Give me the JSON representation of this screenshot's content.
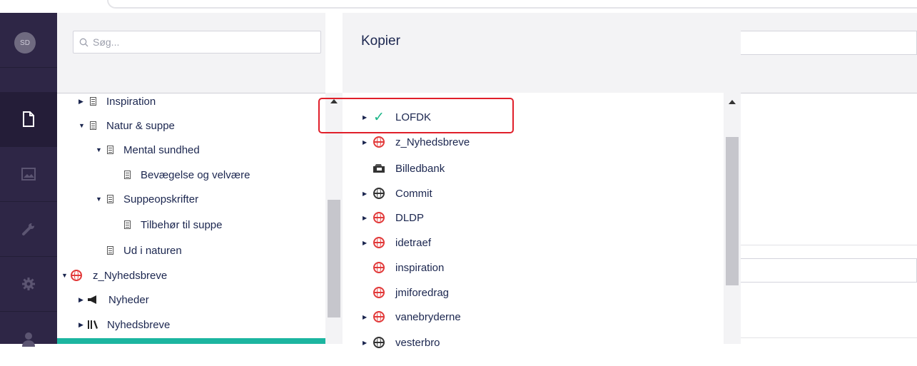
{
  "user": {
    "initials": "SD"
  },
  "search": {
    "placeholder": "Søg..."
  },
  "dialog": {
    "title": "Kopier"
  },
  "tree": [
    {
      "label": "Inspiration"
    },
    {
      "label": "Natur & suppe"
    },
    {
      "label": "Mental sundhed"
    },
    {
      "label": "Bevægelse og velvære"
    },
    {
      "label": "Suppeopskrifter"
    },
    {
      "label": "Tilbehør til suppe"
    },
    {
      "label": "Ud i naturen"
    },
    {
      "label": "z_Nyhedsbreve"
    },
    {
      "label": "Nyheder"
    },
    {
      "label": "Nyhedsbreve"
    }
  ],
  "targets": [
    {
      "label": "LOFDK",
      "icon": "check-icon"
    },
    {
      "label": "z_Nyhedsbreve",
      "icon": "globe-icon",
      "color": "#e23a3a"
    },
    {
      "label": "Billedbank",
      "icon": "media-folder-icon"
    },
    {
      "label": "Commit",
      "icon": "globe-icon",
      "color": "#333333"
    },
    {
      "label": "DLDP",
      "icon": "globe-icon",
      "color": "#e23a3a"
    },
    {
      "label": "idetraef",
      "icon": "globe-icon",
      "color": "#e23a3a"
    },
    {
      "label": "inspiration",
      "icon": "globe-icon",
      "color": "#e23a3a"
    },
    {
      "label": "jmiforedrag",
      "icon": "globe-icon",
      "color": "#e23a3a"
    },
    {
      "label": "vanebryderne",
      "icon": "globe-icon",
      "color": "#e23a3a"
    },
    {
      "label": "vesterbro",
      "icon": "globe-icon",
      "color": "#333333"
    }
  ],
  "colors": {
    "nav": "#2e2646",
    "accent": "#1cb5a0",
    "highlight": "#e01f2a",
    "check": "#1cb588"
  }
}
